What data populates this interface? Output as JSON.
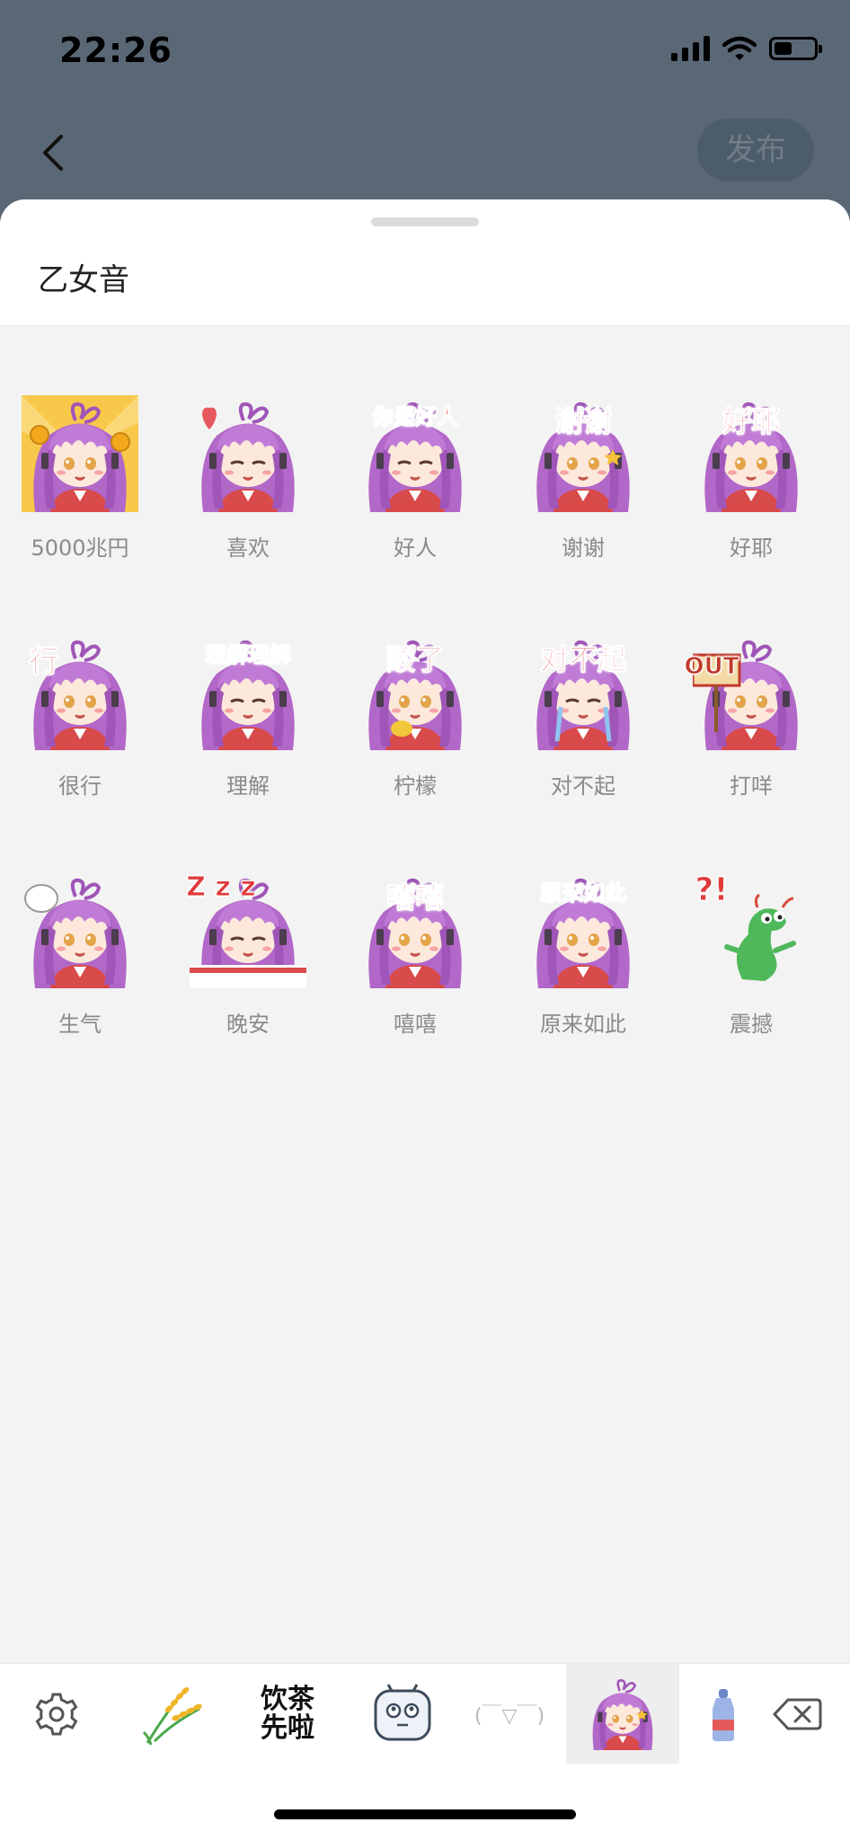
{
  "status_bar": {
    "time": "22:26",
    "battery_level_percent": 45
  },
  "header": {
    "publish_label": "发布"
  },
  "sticker_pack": {
    "title": "乙女音",
    "stickers": [
      {
        "label": "5000兆円",
        "caption": ""
      },
      {
        "label": "喜欢",
        "caption": ""
      },
      {
        "label": "好人",
        "caption": "你是好人"
      },
      {
        "label": "谢谢",
        "caption": "谢谢"
      },
      {
        "label": "好耶",
        "caption": "好耶"
      },
      {
        "label": "很行",
        "caption": "行"
      },
      {
        "label": "理解",
        "caption": "理解理解"
      },
      {
        "label": "柠檬",
        "caption": "酸了"
      },
      {
        "label": "对不起",
        "caption": "对不起"
      },
      {
        "label": "打咩",
        "caption": "OUT"
      },
      {
        "label": "生气",
        "caption": ""
      },
      {
        "label": "晚安",
        "caption": "Z z z"
      },
      {
        "label": "嘻嘻",
        "caption": "嘻嘻"
      },
      {
        "label": "原来如此",
        "caption": "原来如此"
      },
      {
        "label": "震撼",
        "caption": "?!"
      }
    ]
  },
  "toolbar": {
    "items": [
      {
        "icon": "gear-icon"
      },
      {
        "icon": "wheat-sticker-icon"
      },
      {
        "icon": "tea-text-sticker-icon",
        "text_top": "饮茶",
        "text_bottom": "先啦"
      },
      {
        "icon": "tv-mascot-icon"
      },
      {
        "icon": "kaomoji-tab",
        "text": "(￣▽￣)"
      },
      {
        "icon": "otome-sticker-tab",
        "selected": true
      },
      {
        "icon": "bottle-sticker-icon"
      },
      {
        "icon": "backspace-icon"
      }
    ]
  },
  "colors": {
    "accent_pink": "#e7595e",
    "hair_purple": "#b268c8",
    "header_bg": "#5a6876"
  }
}
